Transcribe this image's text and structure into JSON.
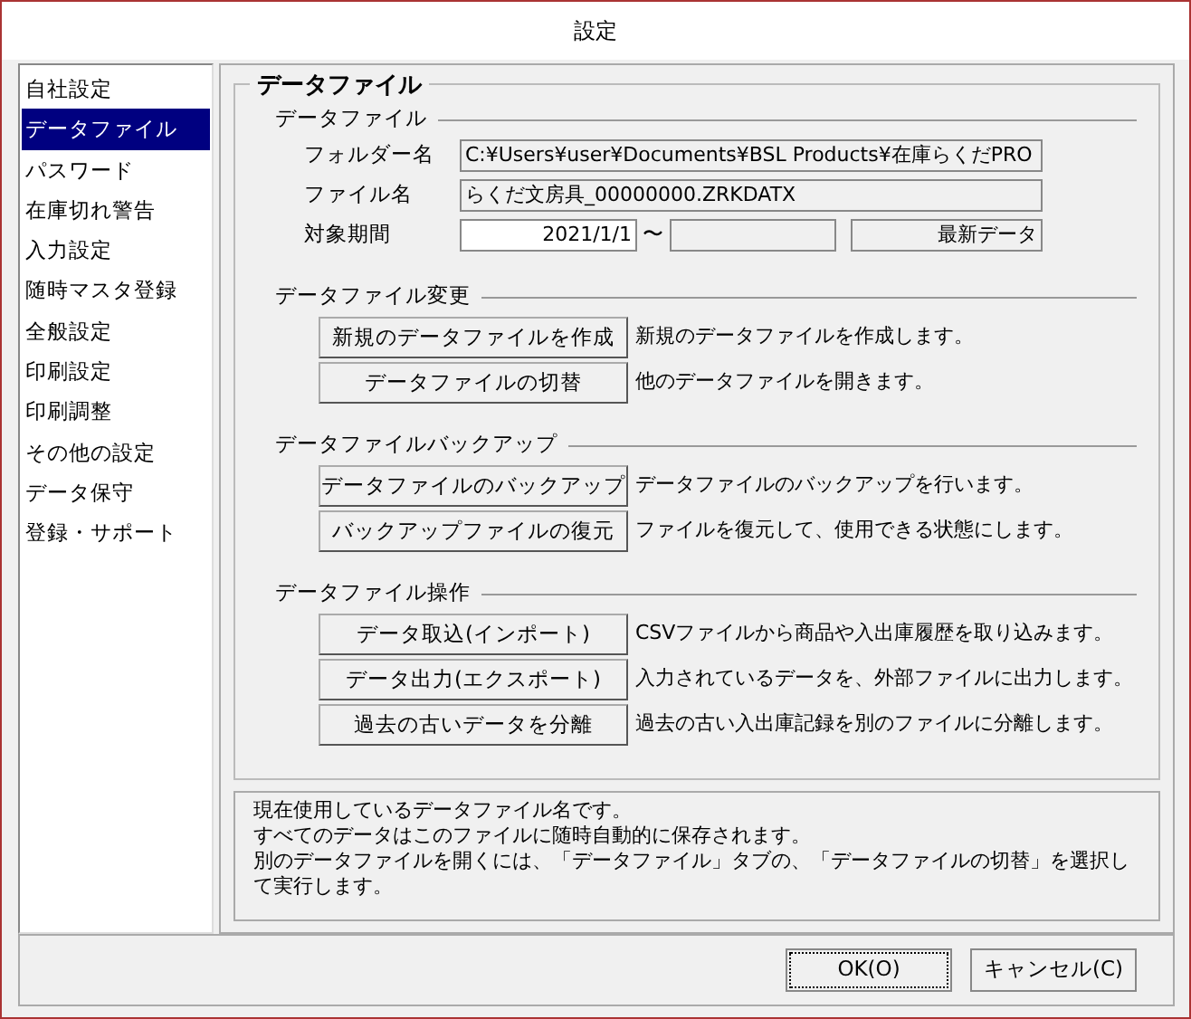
{
  "window": {
    "title": "設定"
  },
  "sidebar": {
    "items": [
      {
        "label": "自社設定",
        "selected": false
      },
      {
        "label": "データファイル",
        "selected": true
      },
      {
        "label": "パスワード",
        "selected": false
      },
      {
        "label": "在庫切れ警告",
        "selected": false
      },
      {
        "label": "入力設定",
        "selected": false
      },
      {
        "label": "随時マスタ登録",
        "selected": false
      },
      {
        "label": "全般設定",
        "selected": false
      },
      {
        "label": "印刷設定",
        "selected": false
      },
      {
        "label": "印刷調整",
        "selected": false
      },
      {
        "label": "その他の設定",
        "selected": false
      },
      {
        "label": "データ保守",
        "selected": false
      },
      {
        "label": "登録・サポート",
        "selected": false
      }
    ]
  },
  "panel": {
    "title": "データファイル",
    "file_info": {
      "title": "データファイル",
      "folder_label": "フォルダー名",
      "folder_value": "C:¥Users¥user¥Documents¥BSL Products¥在庫らくだPRO",
      "file_label": "ファイル名",
      "file_value": "らくだ文房具_00000000.ZRKDATX",
      "period_label": "対象期間",
      "period_from": "2021/1/1",
      "period_separator": "〜",
      "period_latest": "最新データ"
    },
    "groups": [
      {
        "title": "データファイル変更",
        "actions": [
          {
            "button": "新規のデータファイルを作成",
            "description": "新規のデータファイルを作成します。"
          },
          {
            "button": "データファイルの切替",
            "description": "他のデータファイルを開きます。"
          }
        ]
      },
      {
        "title": "データファイルバックアップ",
        "actions": [
          {
            "button": "データファイルのバックアップ",
            "description": "データファイルのバックアップを行います。"
          },
          {
            "button": "バックアップファイルの復元",
            "description": "ファイルを復元して、使用できる状態にします。"
          }
        ]
      },
      {
        "title": "データファイル操作",
        "actions": [
          {
            "button": "データ取込(インポート)",
            "description": "CSVファイルから商品や入出庫履歴を取り込みます。"
          },
          {
            "button": "データ出力(エクスポート)",
            "description": "入力されているデータを、外部ファイルに出力します。"
          },
          {
            "button": "過去の古いデータを分離",
            "description": "過去の古い入出庫記録を別のファイルに分離します。"
          }
        ]
      }
    ]
  },
  "help": {
    "lines": [
      "現在使用しているデータファイル名です。",
      "すべてのデータはこのファイルに随時自動的に保存されます。",
      "別のデータファイルを開くには、「データファイル」タブの、「データファイルの切替」を選択して実行します。"
    ]
  },
  "buttons": [
    {
      "label": "OK(O)",
      "focused": true
    },
    {
      "label": "キャンセル(C)",
      "focused": false
    }
  ]
}
